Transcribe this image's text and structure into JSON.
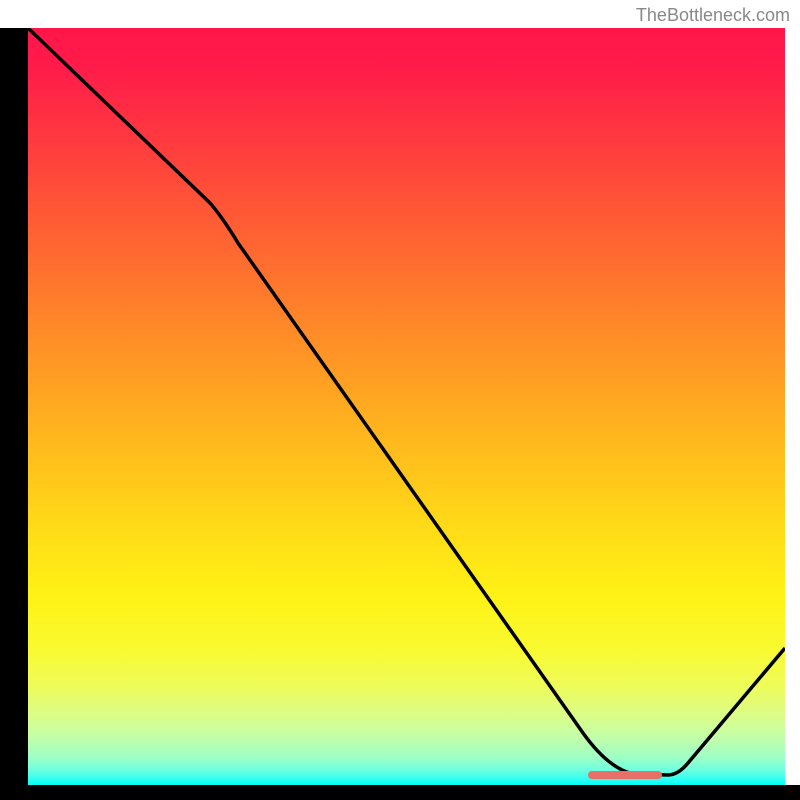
{
  "watermark": "TheBottleneck.com",
  "chart_data": {
    "type": "line",
    "title": "",
    "xlabel": "",
    "ylabel": "",
    "x": [
      0,
      24,
      80,
      85,
      100
    ],
    "values": [
      100,
      77,
      0.8,
      0.8,
      18
    ],
    "xlim": [
      0,
      100
    ],
    "ylim": [
      0,
      100
    ],
    "marker": {
      "x_start": 74,
      "x_end": 84,
      "y": 1
    },
    "background": "vertical-gradient-red-to-green"
  }
}
